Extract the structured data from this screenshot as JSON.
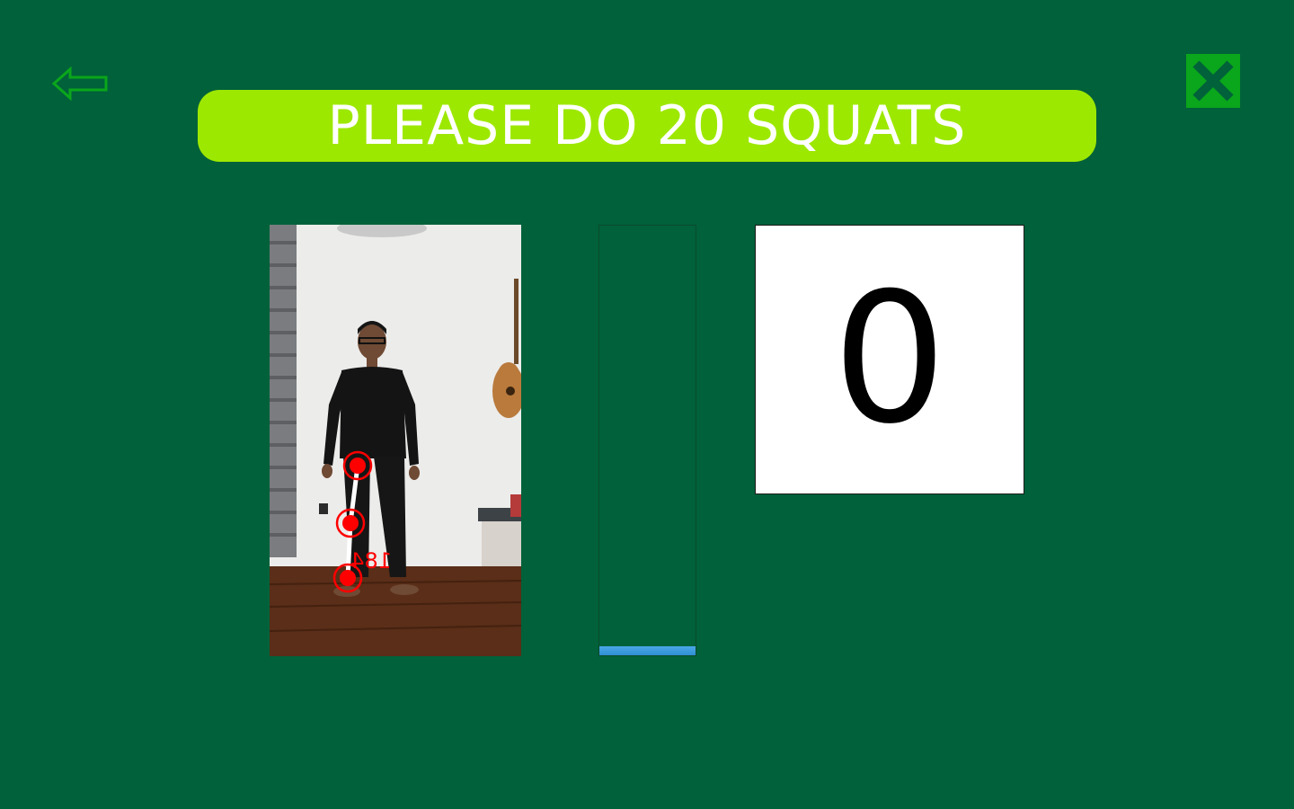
{
  "header": {
    "title": "PLEASE DO 20 SQUATS"
  },
  "icons": {
    "back": "back-arrow-icon",
    "close": "close-x-icon"
  },
  "camera": {
    "angle_label": "184"
  },
  "progress": {
    "fraction": 0.02
  },
  "counter": {
    "value": "0"
  },
  "colors": {
    "background": "#00613a",
    "banner": "#9de800",
    "close_button": "#0aa61b",
    "progress_fill": "#3a9be0",
    "landmark": "#ff0000"
  }
}
